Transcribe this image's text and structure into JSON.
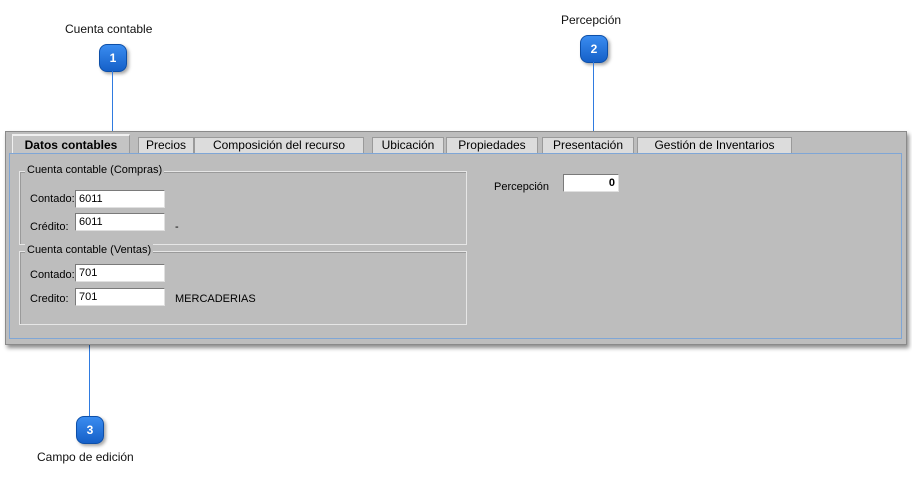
{
  "callouts": [
    {
      "number": "1",
      "label": "Cuenta contable"
    },
    {
      "number": "2",
      "label": "Percepción"
    },
    {
      "number": "3",
      "label": "Campo de edición"
    }
  ],
  "tabs": [
    {
      "label": "Datos contables",
      "active": true
    },
    {
      "label": "Precios"
    },
    {
      "label": "Composición del recurso"
    },
    {
      "label": "Ubicación"
    },
    {
      "label": "Propiedades"
    },
    {
      "label": "Presentación"
    },
    {
      "label": "Gestión de Inventarios"
    }
  ],
  "compras": {
    "title": "Cuenta contable (Compras)",
    "contado_label": "Contado:",
    "contado_value": "6011",
    "credito_label": "Crédito:",
    "credito_value": "6011",
    "credito_desc": "-"
  },
  "ventas": {
    "title": "Cuenta contable (Ventas)",
    "contado_label": "Contado:",
    "contado_value": "701",
    "credito_label": "Credito:",
    "credito_value": "701",
    "credito_desc": "MERCADERIAS"
  },
  "percepcion": {
    "label": "Percepción",
    "value": "0"
  },
  "colors": {
    "badge": "#1f6fd8",
    "leader_line": "#2f7be0",
    "window_bg": "#bdbdbd"
  }
}
